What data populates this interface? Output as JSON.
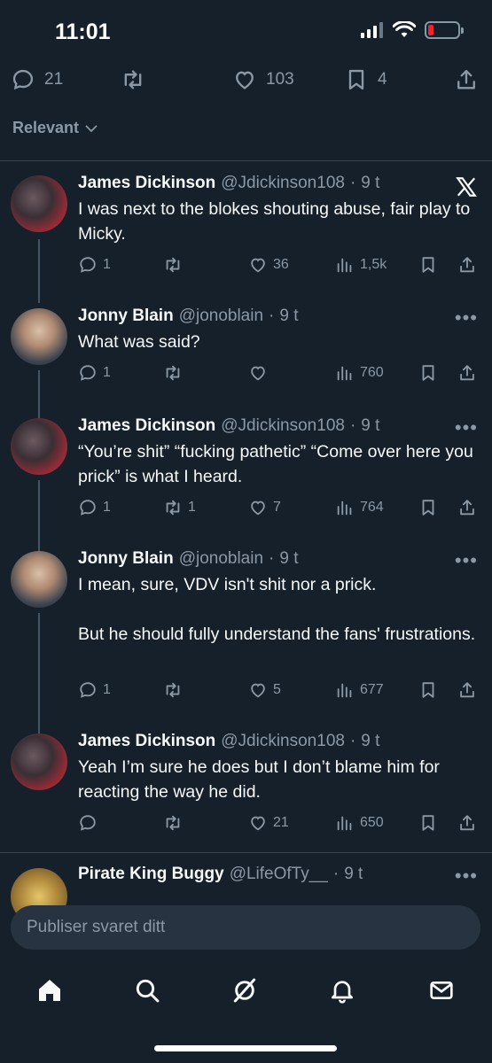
{
  "status_bar": {
    "time": "11:01"
  },
  "post_actions": {
    "replies": "21",
    "likes": "103",
    "bookmarks": "4"
  },
  "filter": {
    "label": "Relevant"
  },
  "tweets": [
    {
      "name": "James Dickinson",
      "handle": "@Jdickinson108",
      "time": "9 t",
      "text": "I was next to the blokes shouting abuse, fair play to Micky.",
      "replies": "1",
      "reposts": "",
      "likes": "36",
      "views": "1,5k"
    },
    {
      "name": "Jonny Blain",
      "handle": "@jonoblain",
      "time": "9 t",
      "text": "What was said?",
      "replies": "1",
      "reposts": "",
      "likes": "",
      "views": "760"
    },
    {
      "name": "James Dickinson",
      "handle": "@Jdickinson108",
      "time": "9 t",
      "text": "“You’re shit” “fucking pathetic” “Come over here you prick” is what I heard.",
      "replies": "1",
      "reposts": "1",
      "likes": "7",
      "views": "764"
    },
    {
      "name": "Jonny Blain",
      "handle": "@jonoblain",
      "time": "9 t",
      "text": "I mean, sure, VDV isn't shit nor a prick.\n\nBut he should fully understand the fans' frustrations.",
      "replies": "1",
      "reposts": "",
      "likes": "5",
      "views": "677"
    },
    {
      "name": "James Dickinson",
      "handle": "@Jdickinson108",
      "time": "9 t",
      "text": "Yeah I’m sure he does but I don’t blame him for reacting the way he did.",
      "replies": "",
      "reposts": "",
      "likes": "21",
      "views": "650"
    },
    {
      "name": "Pirate King Buggy",
      "handle": "@LifeOfTy__",
      "time": "9 t",
      "text": ""
    }
  ],
  "reply_box": {
    "placeholder": "Publiser svaret ditt"
  },
  "tabbar": [
    "home-icon",
    "search-icon",
    "grok-icon",
    "notifications-icon",
    "messages-icon"
  ],
  "colors": {
    "background": "#15202b",
    "muted": "#8b98a5",
    "battery_low": "#f4212e"
  }
}
